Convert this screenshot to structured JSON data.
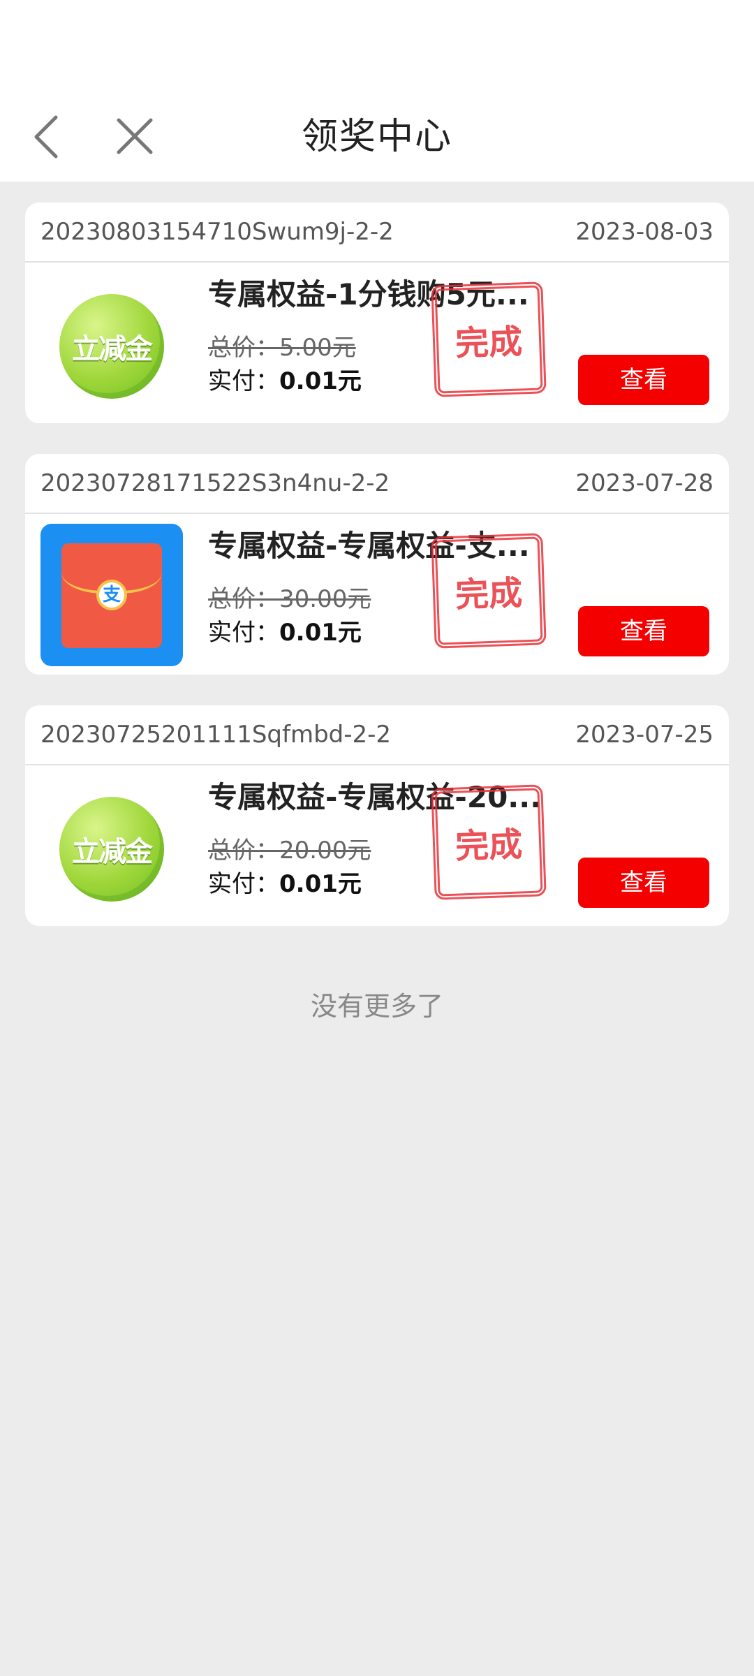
{
  "nav": {
    "title": "领奖中心"
  },
  "orders": [
    {
      "order_no": "20230803154710Swum9j-2-2",
      "date": "2023-08-03",
      "icon": "coin-icon",
      "icon_text": "立减金",
      "title": "专属权益-1分钱购5元...",
      "total_label": "总价：",
      "total_value": "5.00元",
      "paid_label": "实付：",
      "paid_value": "0.01元",
      "stamp": "完成",
      "button": "查看"
    },
    {
      "order_no": "20230728171522S3n4nu-2-2",
      "date": "2023-07-28",
      "icon": "alipay-red-envelope-icon",
      "icon_text": "支",
      "title": "专属权益-专属权益-支...",
      "total_label": "总价：",
      "total_value": "30.00元",
      "paid_label": "实付：",
      "paid_value": "0.01元",
      "stamp": "完成",
      "button": "查看"
    },
    {
      "order_no": "20230725201111Sqfmbd-2-2",
      "date": "2023-07-25",
      "icon": "coin-icon",
      "icon_text": "立减金",
      "title": "专属权益-专属权益-20...",
      "total_label": "总价：",
      "total_value": "20.00元",
      "paid_label": "实付：",
      "paid_value": "0.01元",
      "stamp": "完成",
      "button": "查看"
    }
  ],
  "footer": {
    "no_more": "没有更多了"
  },
  "colors": {
    "accent": "#f40000",
    "stamp": "#e8333a",
    "background": "#ececec"
  }
}
